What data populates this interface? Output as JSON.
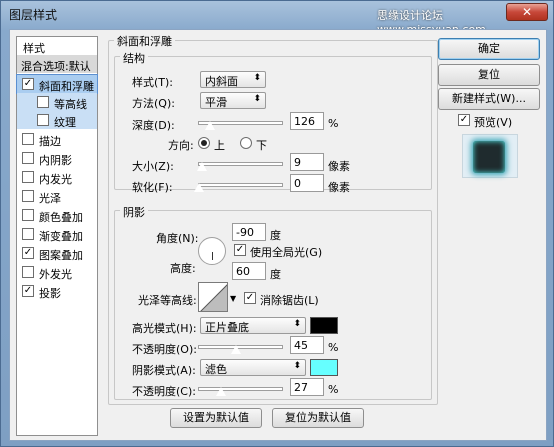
{
  "window": {
    "title": "图层样式",
    "watermark": "思缘设计论坛 www.missyuan.com",
    "close_label": "✕"
  },
  "sidebar": {
    "header": "样式",
    "blend_options": "混合选项:默认",
    "items": [
      {
        "label": "斜面和浮雕",
        "checked": true
      },
      {
        "label": "等高线",
        "checked": false
      },
      {
        "label": "纹理",
        "checked": false
      },
      {
        "label": "描边",
        "checked": false
      },
      {
        "label": "内阴影",
        "checked": false
      },
      {
        "label": "内发光",
        "checked": false
      },
      {
        "label": "光泽",
        "checked": false
      },
      {
        "label": "颜色叠加",
        "checked": false
      },
      {
        "label": "渐变叠加",
        "checked": false
      },
      {
        "label": "图案叠加",
        "checked": true
      },
      {
        "label": "外发光",
        "checked": false
      },
      {
        "label": "投影",
        "checked": true
      }
    ]
  },
  "bevel": {
    "group_title": "斜面和浮雕",
    "structure": {
      "title": "结构",
      "style_label": "样式(T):",
      "style_value": "内斜面",
      "technique_label": "方法(Q):",
      "technique_value": "平滑",
      "depth_label": "深度(D):",
      "depth_value": "126",
      "depth_unit": "%",
      "depth_level": 0.13,
      "direction_label": "方向:",
      "direction_up": "上",
      "direction_down": "下",
      "size_label": "大小(Z):",
      "size_value": "9",
      "size_unit": "像素",
      "size_level": 0.03,
      "soften_label": "软化(F):",
      "soften_value": "0",
      "soften_unit": "像素",
      "soften_level": 0.0
    },
    "shading": {
      "title": "阴影",
      "angle_label": "角度(N):",
      "angle_value": "-90",
      "angle_unit": "度",
      "global_light_label": "使用全局光(G)",
      "global_light_checked": true,
      "altitude_label": "高度:",
      "altitude_value": "60",
      "altitude_unit": "度",
      "gloss_contour_label": "光泽等高线:",
      "anti_alias_label": "消除锯齿(L)",
      "anti_alias_checked": true,
      "highlight_mode_label": "高光模式(H):",
      "highlight_mode_value": "正片叠底",
      "highlight_color": "#000000",
      "highlight_opacity_label": "不透明度(O):",
      "highlight_opacity_value": "45",
      "highlight_opacity_level": 0.45,
      "shadow_mode_label": "阴影模式(A):",
      "shadow_mode_value": "滤色",
      "shadow_color": "#66ffff",
      "shadow_opacity_label": "不透明度(C):",
      "shadow_opacity_value": "27",
      "shadow_opacity_level": 0.27,
      "percent": "%"
    },
    "make_default": "设置为默认值",
    "reset_default": "复位为默认值"
  },
  "actions": {
    "ok": "确定",
    "reset": "复位",
    "new_style": "新建样式(W)...",
    "preview_label": "预览(V)",
    "preview_checked": true
  }
}
